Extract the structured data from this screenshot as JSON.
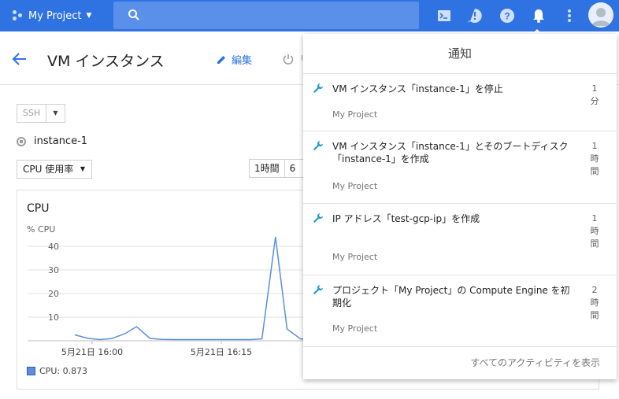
{
  "topbar": {
    "project_label": "My Project",
    "search_placeholder": "",
    "icons": [
      "cloud-shell-icon",
      "alert-icon",
      "help-icon",
      "notifications-icon",
      "more-vert-icon",
      "account-icon"
    ]
  },
  "page": {
    "title": "VM インスタンス",
    "edit_label": "編集",
    "reset_label": "リ"
  },
  "controls": {
    "ssh_label": "SSH",
    "instance_name": "instance-1",
    "metric_select": "CPU 使用率",
    "range_buttons": [
      "1時間",
      "6"
    ]
  },
  "chart": {
    "title": "CPU",
    "legend": "CPU: 0.873"
  },
  "chart_data": {
    "type": "line",
    "title": "CPU",
    "ylabel": "% CPU",
    "xlabel": "",
    "ylim": [
      0,
      45
    ],
    "yticks": [
      10,
      20,
      30,
      40
    ],
    "xtick_labels": [
      "5月21日 16:00",
      "5月21日 16:15"
    ],
    "grid": true,
    "series": [
      {
        "name": "CPU",
        "x": [
          16.1,
          16.8,
          17.4,
          18.0,
          18.7,
          19.3,
          20.0,
          20.6,
          21.3,
          21.9,
          22.6,
          23.2,
          23.9,
          24.5,
          25.2,
          25.8,
          26.5,
          27.1,
          27.8,
          28.4,
          29.1,
          29.7,
          30.4,
          31.0,
          31.7,
          32.3,
          33.0,
          33.6,
          34.3,
          34.9,
          35.6,
          36.2,
          36.9,
          37.5,
          38.2,
          38.8,
          39.5
        ],
        "values": [
          2.5,
          1.0,
          0.5,
          0.9,
          3.0,
          6.0,
          1.0,
          0.6,
          0.5,
          0.5,
          0.5,
          0.5,
          0.5,
          0.5,
          0.5,
          0.8,
          44.0,
          5.0,
          0.8,
          0.5,
          0.5,
          0.6,
          0.8,
          0.7,
          0.6,
          0.6,
          0.7,
          0.7,
          0.6,
          0.8,
          1.0,
          0.7,
          0.7,
          0.6,
          0.6,
          0.6,
          0.6
        ]
      }
    ]
  },
  "notifications": {
    "title": "通知",
    "items": [
      {
        "message": "VM インスタンス「instance-1」を停止",
        "project": "My Project",
        "time": "1分"
      },
      {
        "message": "VM インスタンス「instance-1」とそのブートディスク「instance-1」を作成",
        "project": "My Project",
        "time": "1時間"
      },
      {
        "message": "IP アドレス「test-gcp-ip」を作成",
        "project": "My Project",
        "time": "1時間"
      },
      {
        "message": "プロジェクト「My Project」の Compute Engine を初期化",
        "project": "My Project",
        "time": "2時間"
      }
    ],
    "footer": "すべてのアクティビティを表示"
  },
  "colors": {
    "topbar": "#2f73e3",
    "accent": "#2f73e3",
    "series": "#5b8fde",
    "wrench": "#1e9ac8"
  }
}
